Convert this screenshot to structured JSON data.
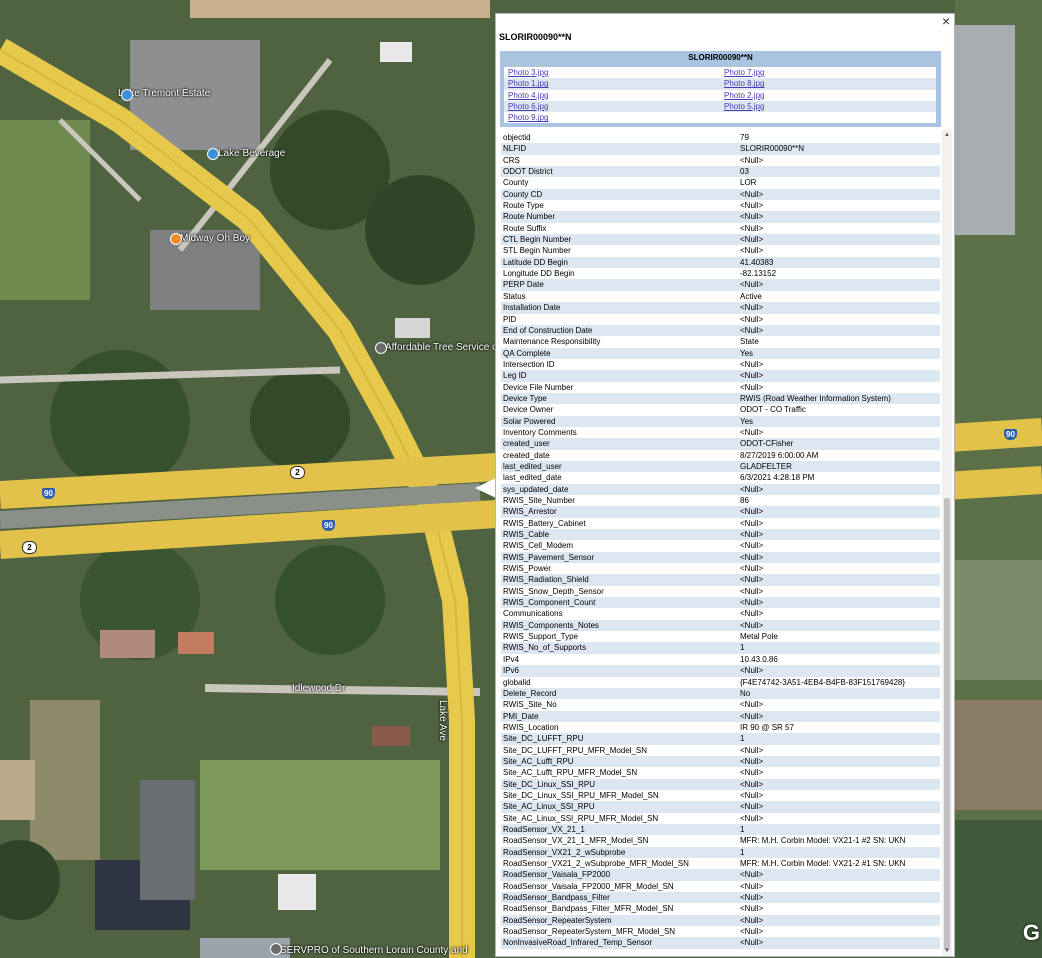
{
  "map": {
    "labels": {
      "place_1": "Lake Tremont Estate",
      "place_2": "Lake Beverage",
      "place_3": "Midway Oh Boy",
      "place_4": "Affordable Tree Service of O",
      "place_5": "SERVPRO of Southern Lorain County and",
      "street_1": "Idlewood Dr",
      "street_2": "Lake Ave"
    },
    "shields": {
      "state_route": "2",
      "interstate": "90"
    },
    "attribution_letter": "G"
  },
  "popup": {
    "close": "×",
    "title": "SLORIR00090**N",
    "photos": {
      "header": "SLORIR00090**N",
      "rows": [
        [
          "Photo 3.jpg",
          "Photo 7.jpg"
        ],
        [
          "Photo 1.jpg",
          "Photo 8.jpg"
        ],
        [
          "Photo 4.jpg",
          "Photo 2.jpg"
        ],
        [
          "Photo 6.jpg",
          "Photo 5.jpg"
        ],
        [
          "Photo 9.jpg",
          ""
        ]
      ]
    },
    "attributes": [
      [
        "objectid",
        "79"
      ],
      [
        "NLFID",
        "SLORIR00090**N"
      ],
      [
        "CRS",
        "<Null>"
      ],
      [
        "ODOT District",
        "03"
      ],
      [
        "County",
        "LOR"
      ],
      [
        "County CD",
        "<Null>"
      ],
      [
        "Route Type",
        "<Null>"
      ],
      [
        "Route Number",
        "<Null>"
      ],
      [
        "Route Suffix",
        "<Null>"
      ],
      [
        "CTL Begin Number",
        "<Null>"
      ],
      [
        "STL Begin Number",
        "<Null>"
      ],
      [
        "Latitude DD Begin",
        "41.40383"
      ],
      [
        "Longitude DD Begin",
        "-82.13152"
      ],
      [
        "PERP Date",
        "<Null>"
      ],
      [
        "Status",
        "Active"
      ],
      [
        "Installation Date",
        "<Null>"
      ],
      [
        "PID",
        "<Null>"
      ],
      [
        "End of Construction Date",
        "<Null>"
      ],
      [
        "Maintenance Responsibility",
        "State"
      ],
      [
        "QA Complete",
        "Yes"
      ],
      [
        "Intersection ID",
        "<Null>"
      ],
      [
        "Leg ID",
        "<Null>"
      ],
      [
        "Device File Number",
        "<Null>"
      ],
      [
        "Device Type",
        "RWIS (Road Weather Information System)"
      ],
      [
        "Device Owner",
        "ODOT - CO Traffic"
      ],
      [
        "Solar Powered",
        "Yes"
      ],
      [
        "Inventory Comments",
        "<Null>"
      ],
      [
        "created_user",
        "ODOT-CFisher"
      ],
      [
        "created_date",
        "8/27/2019 6:00:00 AM"
      ],
      [
        "last_edited_user",
        "GLADFELTER"
      ],
      [
        "last_edited_date",
        "6/3/2021 4:28:18 PM"
      ],
      [
        "sys_updated_date",
        "<Null>"
      ],
      [
        "RWIS_Site_Number",
        "86"
      ],
      [
        "RWIS_Arrestor",
        "<Null>"
      ],
      [
        "RWIS_Battery_Cabinet",
        "<Null>"
      ],
      [
        "RWIS_Cable",
        "<Null>"
      ],
      [
        "RWIS_Cell_Modem",
        "<Null>"
      ],
      [
        "RWIS_Pavement_Sensor",
        "<Null>"
      ],
      [
        "RWIS_Power",
        "<Null>"
      ],
      [
        "RWIS_Radiation_Shield",
        "<Null>"
      ],
      [
        "RWIS_Snow_Depth_Sensor",
        "<Null>"
      ],
      [
        "RWIS_Component_Count",
        "<Null>"
      ],
      [
        "Communications",
        "<Null>"
      ],
      [
        "RWIS_Components_Notes",
        "<Null>"
      ],
      [
        "RWIS_Support_Type",
        "Metal Pole"
      ],
      [
        "RWIS_No_of_Supports",
        "1"
      ],
      [
        "IPv4",
        "10.43.0.86"
      ],
      [
        "IPv6",
        "<Null>"
      ],
      [
        "globalid",
        "{F4E74742-3A51-4EB4-B4FB-83F151769428}"
      ],
      [
        "Delete_Record",
        "No"
      ],
      [
        "RWIS_Site_No",
        "<Null>"
      ],
      [
        "PMI_Date",
        "<Null>"
      ],
      [
        "RWIS_Location",
        "IR 90 @ SR 57"
      ],
      [
        "Site_DC_LUFFT_RPU",
        "1"
      ],
      [
        "Site_DC_LUFFT_RPU_MFR_Model_SN",
        "<Null>"
      ],
      [
        "Site_AC_Lufft_RPU",
        "<Null>"
      ],
      [
        "Site_AC_Lufft_RPU_MFR_Model_SN",
        "<Null>"
      ],
      [
        "Site_DC_Linux_SSI_RPU",
        "<Null>"
      ],
      [
        "Site_DC_Linux_SSI_RPU_MFR_Model_SN",
        "<Null>"
      ],
      [
        "Site_AC_Linux_SSI_RPU",
        "<Null>"
      ],
      [
        "Site_AC_Linux_SSI_RPU_MFR_Model_SN",
        "<Null>"
      ],
      [
        "RoadSensor_VX_21_1",
        "1"
      ],
      [
        "RoadSensor_VX_21_1_MFR_Model_SN",
        "MFR: M.H. Corbin Model: VX21-1 #2 SN: UKN"
      ],
      [
        "RoadSensor_VX21_2_wSubprobe",
        "1"
      ],
      [
        "RoadSensor_VX21_2_wSubprobe_MFR_Model_SN",
        "MFR: M.H. Corbin Model: VX21-2 #1 SN: UKN"
      ],
      [
        "RoadSensor_Vaisala_FP2000",
        "<Null>"
      ],
      [
        "RoadSensor_Vaisala_FP2000_MFR_Model_SN",
        "<Null>"
      ],
      [
        "RoadSensor_Bandpass_Filter",
        "<Null>"
      ],
      [
        "RoadSensor_Bandpass_Filter_MFR_Model_SN",
        "<Null>"
      ],
      [
        "RoadSensor_RepeaterSystem",
        "<Null>"
      ],
      [
        "RoadSensor_RepeaterSystem_MFR_Model_SN",
        "<Null>"
      ],
      [
        "NonInvasiveRoad_Infrared_Temp_Sensor",
        "<Null>"
      ]
    ]
  }
}
